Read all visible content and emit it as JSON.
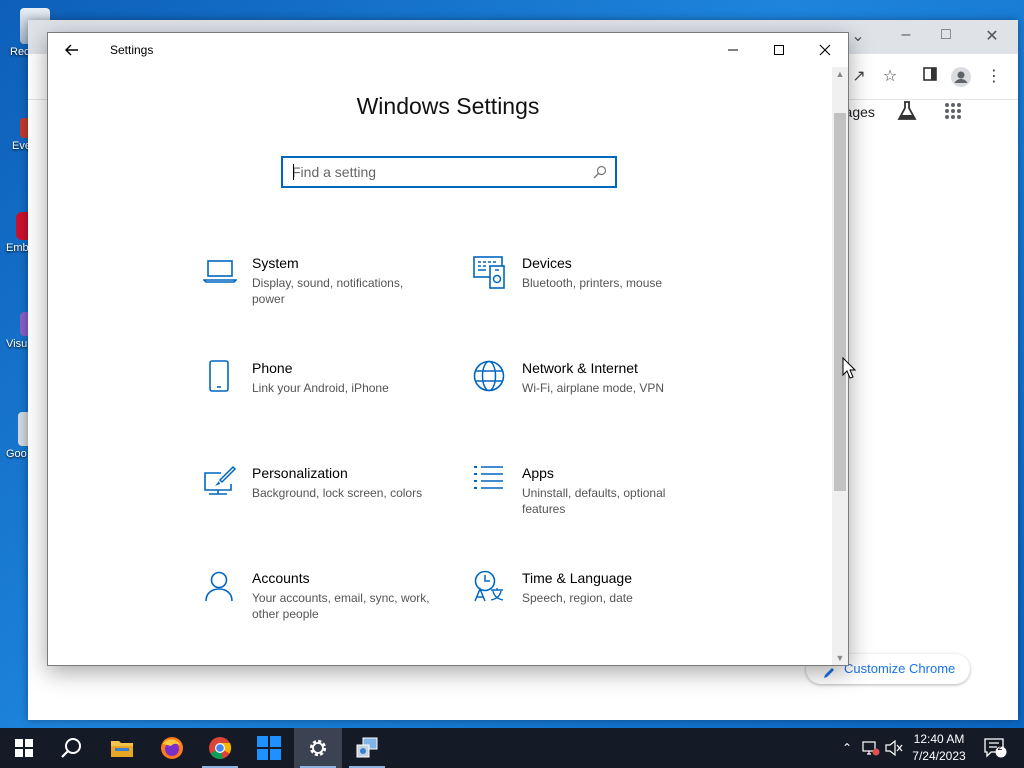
{
  "settings": {
    "window_title": "Settings",
    "heading": "Windows Settings",
    "search_placeholder": "Find a setting",
    "tiles": [
      {
        "title": "System",
        "desc": "Display, sound, notifications, power",
        "icon": "laptop-icon"
      },
      {
        "title": "Devices",
        "desc": "Bluetooth, printers, mouse",
        "icon": "devices-icon"
      },
      {
        "title": "Phone",
        "desc": "Link your Android, iPhone",
        "icon": "phone-icon"
      },
      {
        "title": "Network & Internet",
        "desc": "Wi-Fi, airplane mode, VPN",
        "icon": "globe-icon"
      },
      {
        "title": "Personalization",
        "desc": "Background, lock screen, colors",
        "icon": "paintbrush-icon"
      },
      {
        "title": "Apps",
        "desc": "Uninstall, defaults, optional features",
        "icon": "apps-list-icon"
      },
      {
        "title": "Accounts",
        "desc": "Your accounts, email, sync, work, other people",
        "icon": "person-icon"
      },
      {
        "title": "Time & Language",
        "desc": "Speech, region, date",
        "icon": "time-language-icon"
      }
    ]
  },
  "chrome": {
    "images_link": "Images",
    "customize_label": "Customize Chrome"
  },
  "desktop_icons": [
    {
      "label": "Rec"
    },
    {
      "label": "Eve"
    },
    {
      "label": "Emb"
    },
    {
      "label": "Visu"
    },
    {
      "label": "Goo"
    }
  ],
  "taskbar": {
    "clock_time": "12:40 AM",
    "clock_date": "7/24/2023",
    "notification_count": "2"
  },
  "colors": {
    "accent": "#0067c0",
    "taskbar": "#151b26",
    "desktop": "#1a6fc9"
  }
}
